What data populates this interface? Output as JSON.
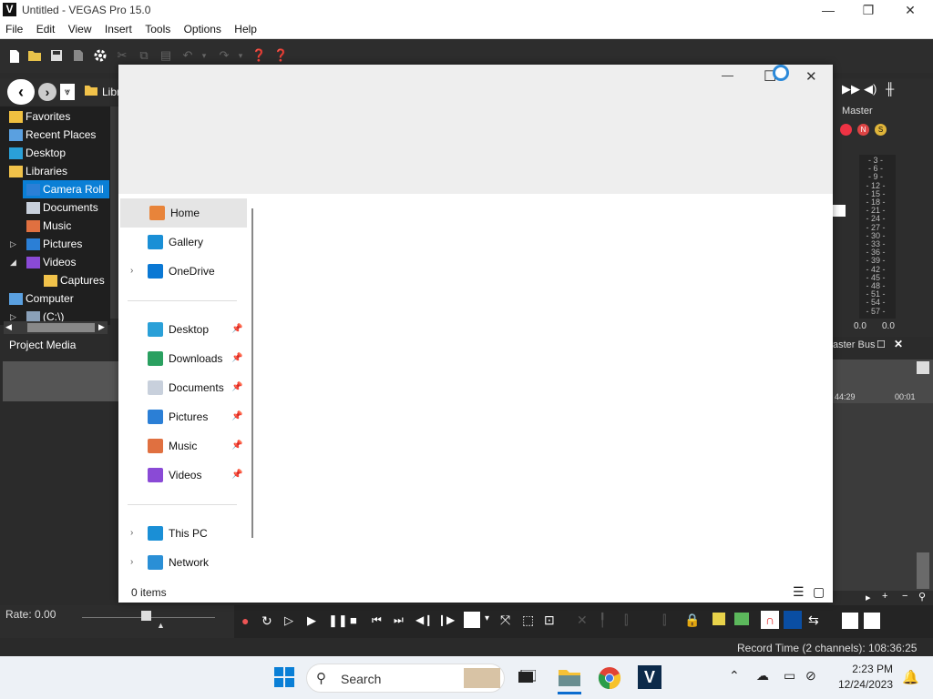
{
  "window": {
    "title": "Untitled - VEGAS Pro 15.0",
    "logo_letter": "V",
    "minimize": "—",
    "maximize": "❐",
    "close": "✕"
  },
  "menu": [
    "File",
    "Edit",
    "View",
    "Insert",
    "Tools",
    "Options",
    "Help"
  ],
  "explorer": {
    "path_label": "Libr",
    "tree": [
      {
        "label": "Favorites",
        "indent": 0,
        "icon": "star-icon"
      },
      {
        "label": "Recent Places",
        "indent": 0,
        "icon": "recent-places-icon"
      },
      {
        "label": "Desktop",
        "indent": 0,
        "icon": "desktop-icon"
      },
      {
        "label": "Libraries",
        "indent": 0,
        "icon": "folder-icon"
      },
      {
        "label": "Camera Roll",
        "indent": 1,
        "icon": "picture-icon",
        "selected": true
      },
      {
        "label": "Documents",
        "indent": 1,
        "icon": "document-icon"
      },
      {
        "label": "Music",
        "indent": 1,
        "icon": "music-icon"
      },
      {
        "label": "Pictures",
        "indent": 1,
        "icon": "picture-icon",
        "expand": "▷"
      },
      {
        "label": "Videos",
        "indent": 1,
        "icon": "video-icon",
        "expand": "◢"
      },
      {
        "label": "Captures",
        "indent": 2,
        "icon": "folder-icon"
      },
      {
        "label": "Computer",
        "indent": 0,
        "icon": "computer-icon"
      },
      {
        "label": "(C:\\)",
        "indent": 1,
        "icon": "drive-icon",
        "expand": "▷"
      }
    ],
    "tab_project_media": "Project Media"
  },
  "master": {
    "label": "Master",
    "meter_ticks": [
      "3",
      "6",
      "9",
      "12",
      "15",
      "18",
      "21",
      "24",
      "27",
      "30",
      "33",
      "36",
      "39",
      "42",
      "45",
      "48",
      "51",
      "54",
      "57"
    ],
    "meter_left": "0.0",
    "meter_right": "0.0",
    "bus_label": "aster Bus"
  },
  "timeline": {
    "time_left": "44:29",
    "time_right": "00:01"
  },
  "transport": {
    "rate": "Rate: 0.00"
  },
  "status": {
    "record_time": "Record Time (2 channels): 108:36:25"
  },
  "dialog": {
    "min": "—",
    "max": "☐",
    "close": "✕",
    "nav_top": [
      {
        "label": "Home",
        "icon": "home-icon",
        "selected": true
      },
      {
        "label": "Gallery",
        "icon": "gallery-icon"
      },
      {
        "label": "OneDrive",
        "icon": "onedrive-icon",
        "chev": "›"
      }
    ],
    "nav_quick": [
      {
        "label": "Desktop",
        "icon": "desktop-icon"
      },
      {
        "label": "Downloads",
        "icon": "download-icon"
      },
      {
        "label": "Documents",
        "icon": "document-icon"
      },
      {
        "label": "Pictures",
        "icon": "picture-icon"
      },
      {
        "label": "Music",
        "icon": "music-icon"
      },
      {
        "label": "Videos",
        "icon": "video-icon"
      }
    ],
    "nav_bottom": [
      {
        "label": "This PC",
        "icon": "this-pc-icon",
        "chev": "›"
      },
      {
        "label": "Network",
        "icon": "network-icon",
        "chev": "›"
      }
    ],
    "items_count": "0 items",
    "pin": "📌"
  },
  "taskbar": {
    "search_label": "Search",
    "time": "2:23 PM",
    "date": "12/24/2023"
  }
}
